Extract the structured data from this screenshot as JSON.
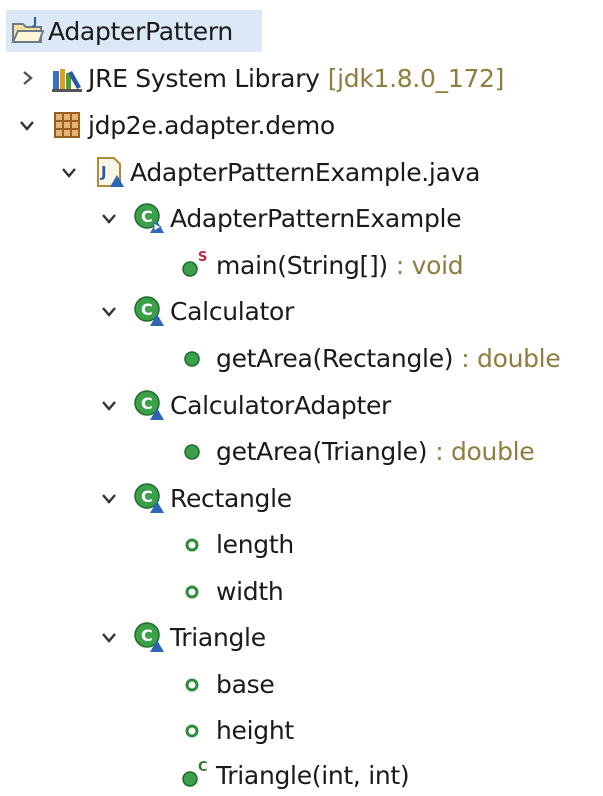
{
  "tree": {
    "project": "AdapterPattern",
    "library": {
      "label": "JRE System Library",
      "qualifier": "[jdk1.8.0_172]"
    },
    "package": "jdp2e.adapter.demo",
    "file": "AdapterPatternExample.java",
    "classes": {
      "main_class": "AdapterPatternExample",
      "main_method": {
        "label": "main(String[])",
        "type": ": void"
      },
      "calculator": "Calculator",
      "calculator_method": {
        "label": "getArea(Rectangle)",
        "type": ": double"
      },
      "calculator_adapter": "CalculatorAdapter",
      "adapter_method": {
        "label": "getArea(Triangle)",
        "type": ": double"
      },
      "rectangle": "Rectangle",
      "rect_field_1": "length",
      "rect_field_2": "width",
      "triangle": "Triangle",
      "tri_field_1": "base",
      "tri_field_2": "height",
      "tri_constructor": "Triangle(int, int)"
    }
  },
  "colors": {
    "selection": "#dbe8f5",
    "class_icon": "#2e9c3e",
    "method_public": "#3aa04a",
    "type_text": "#8e7d3f",
    "package_icon": "#b2752a",
    "static_marker": "#c0264a"
  }
}
